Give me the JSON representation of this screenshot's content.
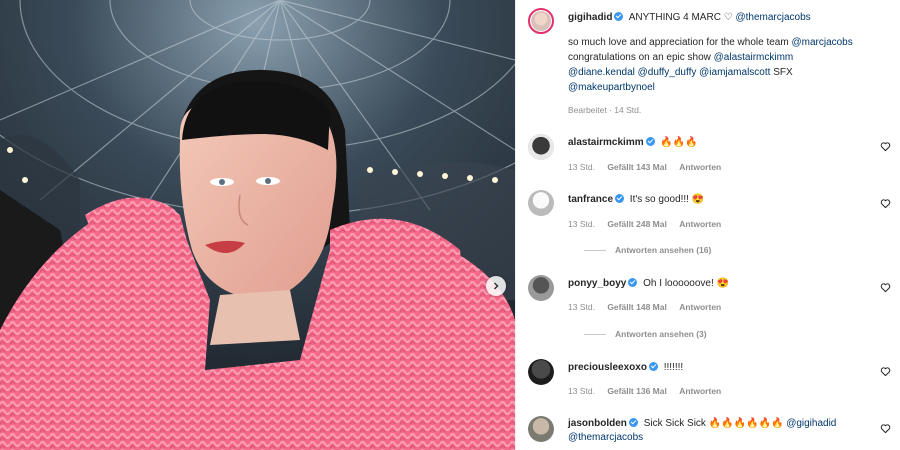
{
  "colors": {
    "accent": "#3897f0",
    "link": "#00376b",
    "muted": "#8e8e8e",
    "sweater": "#f26a8a"
  },
  "post": {
    "author": "gigihadid",
    "caption_head": "ANYTHING 4 MARC ♡",
    "caption_head_mention": "@themarcjacobs",
    "caption_line1": "so much love and appreciation for the whole team",
    "caption_line1_mention": "@marcjacobs",
    "caption_line2": "congratulations on an epic show",
    "caption_line2_mention": "@alastairmckimm",
    "caption_line3_mentions": "@diane.kendal @duffy_duffy @iamjamalscott",
    "caption_line3_text": "SFX",
    "caption_line4_mention": "@makeupartbynoel",
    "edited": "Bearbeitet · 14 Std."
  },
  "comments": [
    {
      "user": "alastairmckimm",
      "text": "🔥🔥🔥",
      "time": "13 Std.",
      "likes": "Gefällt 143 Mal",
      "reply": "Antworten"
    },
    {
      "user": "tanfrance",
      "text": "It's so good!!! 😍",
      "time": "13 Std.",
      "likes": "Gefällt 248 Mal",
      "reply": "Antworten",
      "view_replies": "Antworten ansehen (16)"
    },
    {
      "user": "ponyy_boyy",
      "text": "Oh I loooooove! 😍",
      "time": "13 Std.",
      "likes": "Gefällt 148 Mal",
      "reply": "Antworten",
      "view_replies": "Antworten ansehen (3)"
    },
    {
      "user": "preciousleexoxo",
      "text": "!!!!!!!",
      "time": "13 Std.",
      "likes": "Gefällt 136 Mal",
      "reply": "Antworten"
    },
    {
      "user": "jasonbolden",
      "text": "Sick Sick Sick 🔥🔥🔥🔥🔥🔥",
      "mention1": "@gigihadid",
      "mention2": "@themarcjacobs"
    }
  ],
  "icons": {
    "verified": "verified-badge-icon",
    "heart": "heart-icon",
    "next": "chevron-right-icon"
  }
}
